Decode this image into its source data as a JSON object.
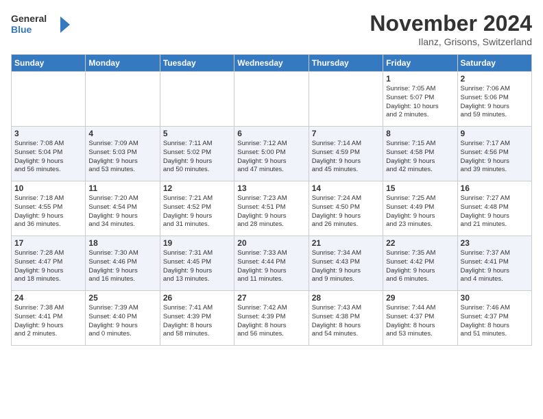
{
  "header": {
    "logo_line1": "General",
    "logo_line2": "Blue",
    "month_year": "November 2024",
    "location": "Ilanz, Grisons, Switzerland"
  },
  "weekdays": [
    "Sunday",
    "Monday",
    "Tuesday",
    "Wednesday",
    "Thursday",
    "Friday",
    "Saturday"
  ],
  "weeks": [
    [
      {
        "day": "",
        "info": ""
      },
      {
        "day": "",
        "info": ""
      },
      {
        "day": "",
        "info": ""
      },
      {
        "day": "",
        "info": ""
      },
      {
        "day": "",
        "info": ""
      },
      {
        "day": "1",
        "info": "Sunrise: 7:05 AM\nSunset: 5:07 PM\nDaylight: 10 hours\nand 2 minutes."
      },
      {
        "day": "2",
        "info": "Sunrise: 7:06 AM\nSunset: 5:06 PM\nDaylight: 9 hours\nand 59 minutes."
      }
    ],
    [
      {
        "day": "3",
        "info": "Sunrise: 7:08 AM\nSunset: 5:04 PM\nDaylight: 9 hours\nand 56 minutes."
      },
      {
        "day": "4",
        "info": "Sunrise: 7:09 AM\nSunset: 5:03 PM\nDaylight: 9 hours\nand 53 minutes."
      },
      {
        "day": "5",
        "info": "Sunrise: 7:11 AM\nSunset: 5:02 PM\nDaylight: 9 hours\nand 50 minutes."
      },
      {
        "day": "6",
        "info": "Sunrise: 7:12 AM\nSunset: 5:00 PM\nDaylight: 9 hours\nand 47 minutes."
      },
      {
        "day": "7",
        "info": "Sunrise: 7:14 AM\nSunset: 4:59 PM\nDaylight: 9 hours\nand 45 minutes."
      },
      {
        "day": "8",
        "info": "Sunrise: 7:15 AM\nSunset: 4:58 PM\nDaylight: 9 hours\nand 42 minutes."
      },
      {
        "day": "9",
        "info": "Sunrise: 7:17 AM\nSunset: 4:56 PM\nDaylight: 9 hours\nand 39 minutes."
      }
    ],
    [
      {
        "day": "10",
        "info": "Sunrise: 7:18 AM\nSunset: 4:55 PM\nDaylight: 9 hours\nand 36 minutes."
      },
      {
        "day": "11",
        "info": "Sunrise: 7:20 AM\nSunset: 4:54 PM\nDaylight: 9 hours\nand 34 minutes."
      },
      {
        "day": "12",
        "info": "Sunrise: 7:21 AM\nSunset: 4:52 PM\nDaylight: 9 hours\nand 31 minutes."
      },
      {
        "day": "13",
        "info": "Sunrise: 7:23 AM\nSunset: 4:51 PM\nDaylight: 9 hours\nand 28 minutes."
      },
      {
        "day": "14",
        "info": "Sunrise: 7:24 AM\nSunset: 4:50 PM\nDaylight: 9 hours\nand 26 minutes."
      },
      {
        "day": "15",
        "info": "Sunrise: 7:25 AM\nSunset: 4:49 PM\nDaylight: 9 hours\nand 23 minutes."
      },
      {
        "day": "16",
        "info": "Sunrise: 7:27 AM\nSunset: 4:48 PM\nDaylight: 9 hours\nand 21 minutes."
      }
    ],
    [
      {
        "day": "17",
        "info": "Sunrise: 7:28 AM\nSunset: 4:47 PM\nDaylight: 9 hours\nand 18 minutes."
      },
      {
        "day": "18",
        "info": "Sunrise: 7:30 AM\nSunset: 4:46 PM\nDaylight: 9 hours\nand 16 minutes."
      },
      {
        "day": "19",
        "info": "Sunrise: 7:31 AM\nSunset: 4:45 PM\nDaylight: 9 hours\nand 13 minutes."
      },
      {
        "day": "20",
        "info": "Sunrise: 7:33 AM\nSunset: 4:44 PM\nDaylight: 9 hours\nand 11 minutes."
      },
      {
        "day": "21",
        "info": "Sunrise: 7:34 AM\nSunset: 4:43 PM\nDaylight: 9 hours\nand 9 minutes."
      },
      {
        "day": "22",
        "info": "Sunrise: 7:35 AM\nSunset: 4:42 PM\nDaylight: 9 hours\nand 6 minutes."
      },
      {
        "day": "23",
        "info": "Sunrise: 7:37 AM\nSunset: 4:41 PM\nDaylight: 9 hours\nand 4 minutes."
      }
    ],
    [
      {
        "day": "24",
        "info": "Sunrise: 7:38 AM\nSunset: 4:41 PM\nDaylight: 9 hours\nand 2 minutes."
      },
      {
        "day": "25",
        "info": "Sunrise: 7:39 AM\nSunset: 4:40 PM\nDaylight: 9 hours\nand 0 minutes."
      },
      {
        "day": "26",
        "info": "Sunrise: 7:41 AM\nSunset: 4:39 PM\nDaylight: 8 hours\nand 58 minutes."
      },
      {
        "day": "27",
        "info": "Sunrise: 7:42 AM\nSunset: 4:39 PM\nDaylight: 8 hours\nand 56 minutes."
      },
      {
        "day": "28",
        "info": "Sunrise: 7:43 AM\nSunset: 4:38 PM\nDaylight: 8 hours\nand 54 minutes."
      },
      {
        "day": "29",
        "info": "Sunrise: 7:44 AM\nSunset: 4:37 PM\nDaylight: 8 hours\nand 53 minutes."
      },
      {
        "day": "30",
        "info": "Sunrise: 7:46 AM\nSunset: 4:37 PM\nDaylight: 8 hours\nand 51 minutes."
      }
    ]
  ]
}
